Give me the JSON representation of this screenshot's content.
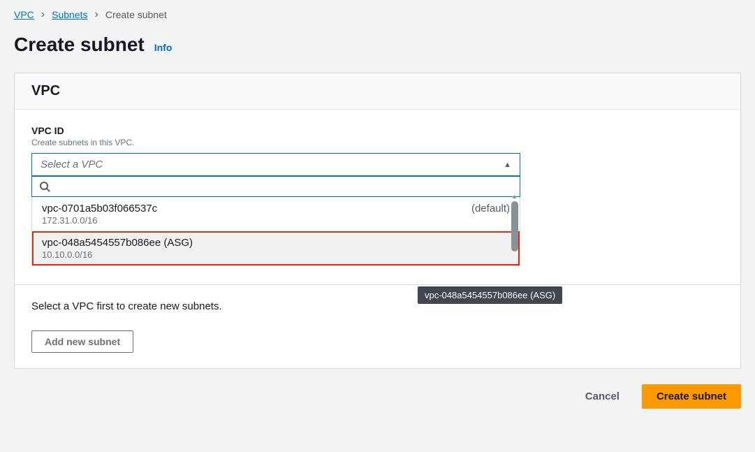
{
  "breadcrumb": {
    "vpc": "VPC",
    "subnets": "Subnets",
    "current": "Create subnet"
  },
  "header": {
    "title": "Create subnet",
    "info": "Info"
  },
  "vpc_panel": {
    "title": "VPC",
    "field_label": "VPC ID",
    "field_desc": "Create subnets in this VPC.",
    "placeholder": "Select a VPC"
  },
  "dropdown": {
    "options": [
      {
        "id": "vpc-0701a5b03f066537c",
        "cidr": "172.31.0.0/16",
        "tag": "(default)"
      },
      {
        "id": "vpc-048a5454557b086ee (ASG)",
        "cidr": "10.10.0.0/16",
        "tag": ""
      }
    ]
  },
  "tooltip": "vpc-048a5454557b086ee (ASG)",
  "subnet_section": {
    "message": "Select a VPC first to create new subnets.",
    "add_button": "Add new subnet"
  },
  "footer": {
    "cancel": "Cancel",
    "create": "Create subnet"
  }
}
